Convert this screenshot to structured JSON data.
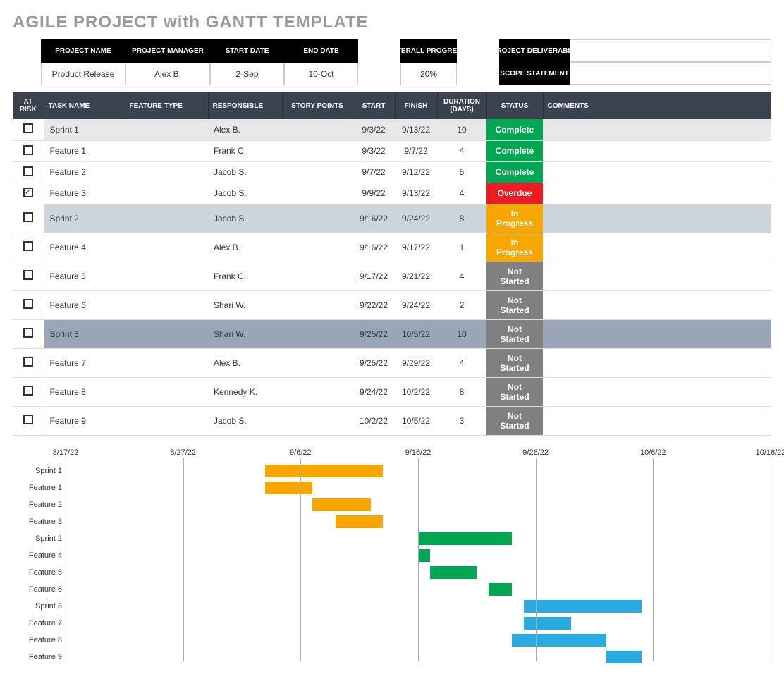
{
  "title": "AGILE PROJECT with GANTT TEMPLATE",
  "meta": {
    "headers": [
      "PROJECT NAME",
      "PROJECT MANAGER",
      "START DATE",
      "END DATE"
    ],
    "values": [
      "Product Release",
      "Alex B.",
      "2-Sep",
      "10-Oct"
    ],
    "overall_label": "OVERALL PROGRESS",
    "overall_value": "20%",
    "deliverable_label": "PROJECT DELIVERABLE",
    "deliverable_value": "",
    "scope_label": "SCOPE STATEMENT",
    "scope_value": ""
  },
  "columns": [
    "AT RISK",
    "TASK NAME",
    "FEATURE TYPE",
    "RESPONSIBLE",
    "STORY POINTS",
    "START",
    "FINISH",
    "DURATION (DAYS)",
    "STATUS",
    "COMMENTS"
  ],
  "status_colors": {
    "Complete": "#00a651",
    "Overdue": "#ed1c24",
    "In Progress": "#f7a700",
    "Not Started": "#808080"
  },
  "rows": [
    {
      "group": "sprint1",
      "at_risk": false,
      "task": "Sprint 1",
      "feature": "",
      "resp": "Alex B.",
      "story": "",
      "start": "9/3/22",
      "finish": "9/13/22",
      "dur": "10",
      "status": "Complete",
      "comments": ""
    },
    {
      "group": "",
      "at_risk": false,
      "task": "Feature 1",
      "feature": "",
      "resp": "Frank C.",
      "story": "",
      "start": "9/3/22",
      "finish": "9/7/22",
      "dur": "4",
      "status": "Complete",
      "comments": ""
    },
    {
      "group": "",
      "at_risk": false,
      "task": "Feature 2",
      "feature": "",
      "resp": "Jacob S.",
      "story": "",
      "start": "9/7/22",
      "finish": "9/12/22",
      "dur": "5",
      "status": "Complete",
      "comments": ""
    },
    {
      "group": "",
      "at_risk": true,
      "task": "Feature 3",
      "feature": "",
      "resp": "Jacob S.",
      "story": "",
      "start": "9/9/22",
      "finish": "9/13/22",
      "dur": "4",
      "status": "Overdue",
      "comments": ""
    },
    {
      "group": "sprint2",
      "at_risk": false,
      "task": "Sprint 2",
      "feature": "",
      "resp": "Jacob S.",
      "story": "",
      "start": "9/16/22",
      "finish": "9/24/22",
      "dur": "8",
      "status": "In Progress",
      "comments": ""
    },
    {
      "group": "",
      "at_risk": false,
      "task": "Feature 4",
      "feature": "",
      "resp": "Alex B.",
      "story": "",
      "start": "9/16/22",
      "finish": "9/17/22",
      "dur": "1",
      "status": "In Progress",
      "comments": ""
    },
    {
      "group": "",
      "at_risk": false,
      "task": "Feature 5",
      "feature": "",
      "resp": "Frank C.",
      "story": "",
      "start": "9/17/22",
      "finish": "9/21/22",
      "dur": "4",
      "status": "Not Started",
      "comments": ""
    },
    {
      "group": "",
      "at_risk": false,
      "task": "Feature 6",
      "feature": "",
      "resp": "Shari W.",
      "story": "",
      "start": "9/22/22",
      "finish": "9/24/22",
      "dur": "2",
      "status": "Not Started",
      "comments": ""
    },
    {
      "group": "sprint3",
      "at_risk": false,
      "task": "Sprint 3",
      "feature": "",
      "resp": "Shari W.",
      "story": "",
      "start": "9/25/22",
      "finish": "10/5/22",
      "dur": "10",
      "status": "Not Started",
      "comments": ""
    },
    {
      "group": "",
      "at_risk": false,
      "task": "Feature 7",
      "feature": "",
      "resp": "Alex B.",
      "story": "",
      "start": "9/25/22",
      "finish": "9/29/22",
      "dur": "4",
      "status": "Not Started",
      "comments": ""
    },
    {
      "group": "",
      "at_risk": false,
      "task": "Feature 8",
      "feature": "",
      "resp": "Kennedy K.",
      "story": "",
      "start": "9/24/22",
      "finish": "10/2/22",
      "dur": "8",
      "status": "Not Started",
      "comments": ""
    },
    {
      "group": "",
      "at_risk": false,
      "task": "Feature 9",
      "feature": "",
      "resp": "Jacob S.",
      "story": "",
      "start": "10/2/22",
      "finish": "10/5/22",
      "dur": "3",
      "status": "Not Started",
      "comments": ""
    }
  ],
  "chart_data": {
    "type": "bar",
    "orientation": "horizontal-gantt",
    "title": "",
    "x_axis_type": "date",
    "x_min": "8/17/22",
    "x_max": "10/16/22",
    "x_ticks": [
      "8/17/22",
      "8/27/22",
      "9/6/22",
      "9/16/22",
      "9/26/22",
      "10/6/22",
      "10/16/22"
    ],
    "series_colors": {
      "group1": "#f7a700",
      "group2": "#00a651",
      "group3": "#29abe2"
    },
    "bars": [
      {
        "label": "Sprint 1",
        "start": "9/3/22",
        "end": "9/13/22",
        "color": "#f7a700"
      },
      {
        "label": "Feature 1",
        "start": "9/3/22",
        "end": "9/7/22",
        "color": "#f7a700"
      },
      {
        "label": "Feature 2",
        "start": "9/7/22",
        "end": "9/12/22",
        "color": "#f7a700"
      },
      {
        "label": "Feature 3",
        "start": "9/9/22",
        "end": "9/13/22",
        "color": "#f7a700"
      },
      {
        "label": "Sprint 2",
        "start": "9/16/22",
        "end": "9/24/22",
        "color": "#00a651"
      },
      {
        "label": "Feature 4",
        "start": "9/16/22",
        "end": "9/17/22",
        "color": "#00a651"
      },
      {
        "label": "Feature 5",
        "start": "9/17/22",
        "end": "9/21/22",
        "color": "#00a651"
      },
      {
        "label": "Feature 6",
        "start": "9/22/22",
        "end": "9/24/22",
        "color": "#00a651"
      },
      {
        "label": "Sprint 3",
        "start": "9/25/22",
        "end": "10/5/22",
        "color": "#29abe2"
      },
      {
        "label": "Feature 7",
        "start": "9/25/22",
        "end": "9/29/22",
        "color": "#29abe2"
      },
      {
        "label": "Feature 8",
        "start": "9/24/22",
        "end": "10/2/22",
        "color": "#29abe2"
      },
      {
        "label": "Feature 9",
        "start": "10/2/22",
        "end": "10/5/22",
        "color": "#29abe2"
      }
    ]
  }
}
